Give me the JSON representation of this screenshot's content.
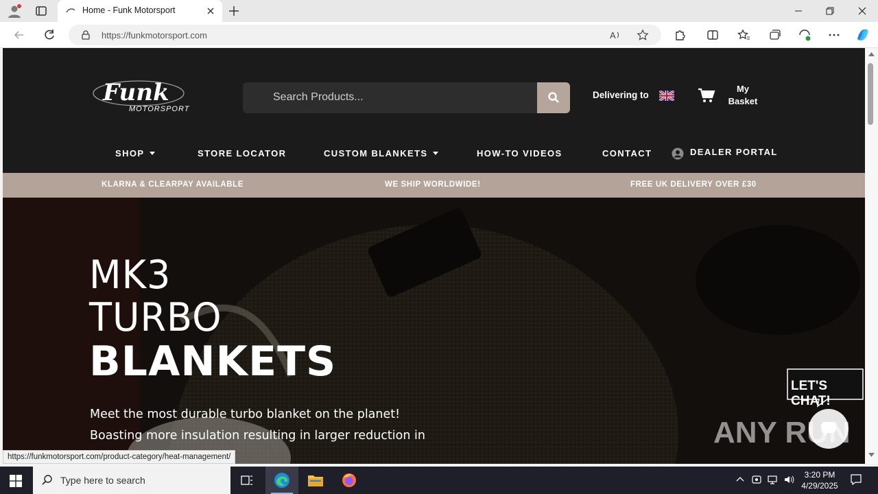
{
  "browser": {
    "tab_title": "Home - Funk Motorsport",
    "url_host": "https://funkmotorsport.com",
    "status_url": "https://funkmotorsport.com/product-category/heat-management/"
  },
  "header": {
    "logo_text": "Funk",
    "logo_sub": "MOTORSPORT",
    "search_placeholder": "Search Products...",
    "delivering_label": "Delivering to",
    "basket_label_1": "My",
    "basket_label_2": "Basket"
  },
  "nav": {
    "shop": "SHOP",
    "store_locator": "STORE LOCATOR",
    "custom_blankets": "CUSTOM BLANKETS",
    "howto": "HOW-TO VIDEOS",
    "contact": "CONTACT",
    "dealer": "DEALER PORTAL"
  },
  "promo": {
    "left": "KLARNA & CLEARPAY AVAILABLE",
    "center": "WE SHIP WORLDWIDE!",
    "right": "FREE UK DELIVERY OVER £30"
  },
  "hero": {
    "line1": "MK3",
    "line2": "TURBO",
    "line3": "BLANKETS",
    "desc1": "Meet the most durable turbo blanket on the planet!",
    "desc2": "Boasting more insulation resulting in larger reduction in"
  },
  "chat": {
    "label": "LET'S CHAT!"
  },
  "watermark": "ANY RUN",
  "taskbar": {
    "search_text": "Type here to search",
    "time": "3:20 PM",
    "date": "4/29/2025"
  },
  "colors": {
    "header_bg": "#1b1b1b",
    "promo_bg": "#b3a398",
    "search_btn": "#b5a59a"
  }
}
